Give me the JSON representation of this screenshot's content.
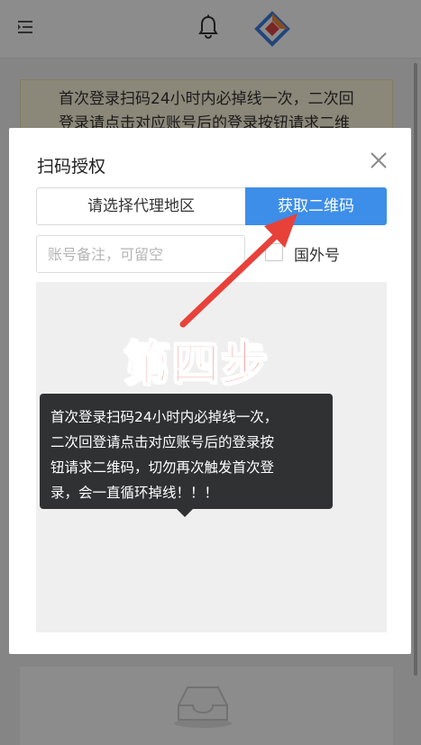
{
  "background": {
    "notice_lines": [
      "首次登录扫码24小时内必掉线一次，二次回",
      "登录请点击对应账号后的登录按钮请求二维"
    ]
  },
  "modal": {
    "title": "扫码授权",
    "region_select": "请选择代理地区",
    "qr_button": "获取二维码",
    "remark_placeholder": "账号备注，可留空",
    "foreign_label": "国外号"
  },
  "annotation": {
    "step_label": "第四步"
  },
  "tooltip": {
    "lines": [
      "首次登录扫码24小时内必掉线一次，",
      "二次回登请点击对应账号后的登录按",
      "钮请求二维码，切勿再次触发首次登",
      "录，会一直循环掉线！！！"
    ]
  },
  "colors": {
    "primary": "#3d8ee8",
    "annotation_red": "#e8413a",
    "tooltip_bg": "#303133",
    "notice_bg": "#fdf6dc"
  },
  "icons": [
    "menu-icon",
    "bell-icon",
    "logo-icon",
    "close-icon",
    "inbox-icon"
  ]
}
